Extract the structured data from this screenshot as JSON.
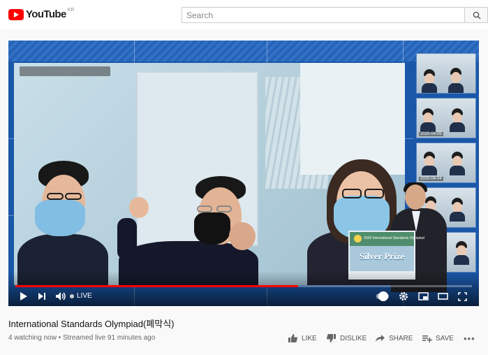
{
  "header": {
    "logo_text": "YouTube",
    "region": "KR",
    "search_placeholder": "Search"
  },
  "video": {
    "live_label": "LIVE",
    "progress": 0.62,
    "prize_board": {
      "subtitle": "2020 International Standards Olympiad",
      "title": "Silver Prize"
    },
    "thumbnail_dates": [
      "2020-04-05",
      "2020-04-04"
    ],
    "feed_stamp": "2020-04-03"
  },
  "info": {
    "title": "International Standards Olympiad(폐막식)",
    "meta": "4 watching now • Streamed live 91 minutes ago"
  },
  "actions": {
    "like": "LIKE",
    "dislike": "DISLIKE",
    "share": "SHARE",
    "save": "SAVE",
    "more": "•••"
  },
  "icons": [
    "youtube-logo-icon",
    "search-icon",
    "play-icon",
    "next-icon",
    "volume-icon",
    "settings-icon",
    "miniplayer-icon",
    "theater-icon",
    "fullscreen-icon",
    "like-icon",
    "dislike-icon",
    "share-icon",
    "save-icon",
    "more-icon"
  ],
  "colors": {
    "brand": "#ff0000",
    "video_bg": "#1a57a8"
  }
}
